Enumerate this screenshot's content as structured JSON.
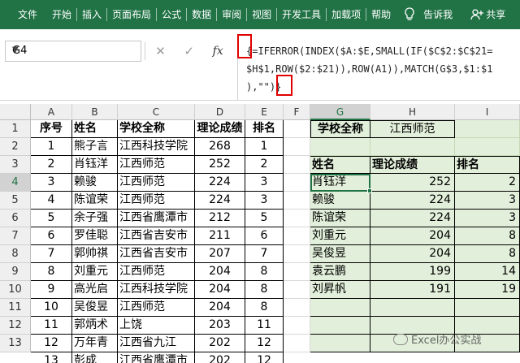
{
  "ribbon": {
    "tabs": [
      "文件",
      "开始",
      "插入",
      "页面布局",
      "公式",
      "数据",
      "审阅",
      "视图",
      "开发工具",
      "加载项",
      "帮助"
    ],
    "tell_me": "告诉我",
    "share": "共享"
  },
  "formula_bar": {
    "name_box": "G4",
    "cancel_symbol": "✕",
    "enter_symbol": "✓",
    "fx_label": "fx",
    "formula_line1": "{=IFERROR(INDEX($A:$E,SMALL(IF($C$2:$C$21=",
    "formula_line2": "$H$1,ROW($2:$21)),ROW(A1)),MATCH(G$3,$1:$1",
    "formula_line3": "),\"\")}"
  },
  "columns": [
    "A",
    "B",
    "C",
    "D",
    "E",
    "F",
    "G",
    "H",
    "I"
  ],
  "row_numbers": [
    "1",
    "2",
    "3",
    "4",
    "5",
    "6",
    "7",
    "8",
    "9",
    "10",
    "11",
    "12",
    "13"
  ],
  "left_table": {
    "headers": [
      "序号",
      "姓名",
      "学校全称",
      "理论成绩",
      "排名"
    ],
    "rows": [
      [
        "1",
        "熊子言",
        "江西科技学院",
        "268",
        "1"
      ],
      [
        "2",
        "肖钰洋",
        "江西师范",
        "252",
        "2"
      ],
      [
        "3",
        "赖骏",
        "江西师范",
        "224",
        "3"
      ],
      [
        "4",
        "陈谊荣",
        "江西师范",
        "224",
        "3"
      ],
      [
        "5",
        "余子强",
        "江西省鹰潭市",
        "212",
        "5"
      ],
      [
        "6",
        "罗佳聪",
        "江西省吉安市",
        "211",
        "6"
      ],
      [
        "7",
        "郭帅祺",
        "江西省吉安市",
        "207",
        "7"
      ],
      [
        "8",
        "刘重元",
        "江西师范",
        "204",
        "8"
      ],
      [
        "9",
        "高光启",
        "江西科技学院",
        "204",
        "8"
      ],
      [
        "10",
        "吴俊昱",
        "江西师范",
        "204",
        "8"
      ],
      [
        "11",
        "郭炳术",
        "上饶",
        "203",
        "11"
      ],
      [
        "12",
        "万年青",
        "江西省九江",
        "202",
        "12"
      ],
      [
        "13",
        "彭成",
        "江西省鹰潭市",
        "202",
        "12"
      ]
    ]
  },
  "criteria": {
    "label": "学校全称",
    "value": "江西师范"
  },
  "right_table": {
    "headers": [
      "姓名",
      "理论成绩",
      "排名"
    ],
    "rows": [
      [
        "肖钰洋",
        "252",
        "2"
      ],
      [
        "赖骏",
        "224",
        "3"
      ],
      [
        "陈谊荣",
        "224",
        "3"
      ],
      [
        "刘重元",
        "204",
        "8"
      ],
      [
        "吴俊昱",
        "204",
        "8"
      ],
      [
        "袁云鹏",
        "199",
        "14"
      ],
      [
        "刘昇帆",
        "191",
        "19"
      ]
    ]
  },
  "watermark": "Excel办公实战"
}
